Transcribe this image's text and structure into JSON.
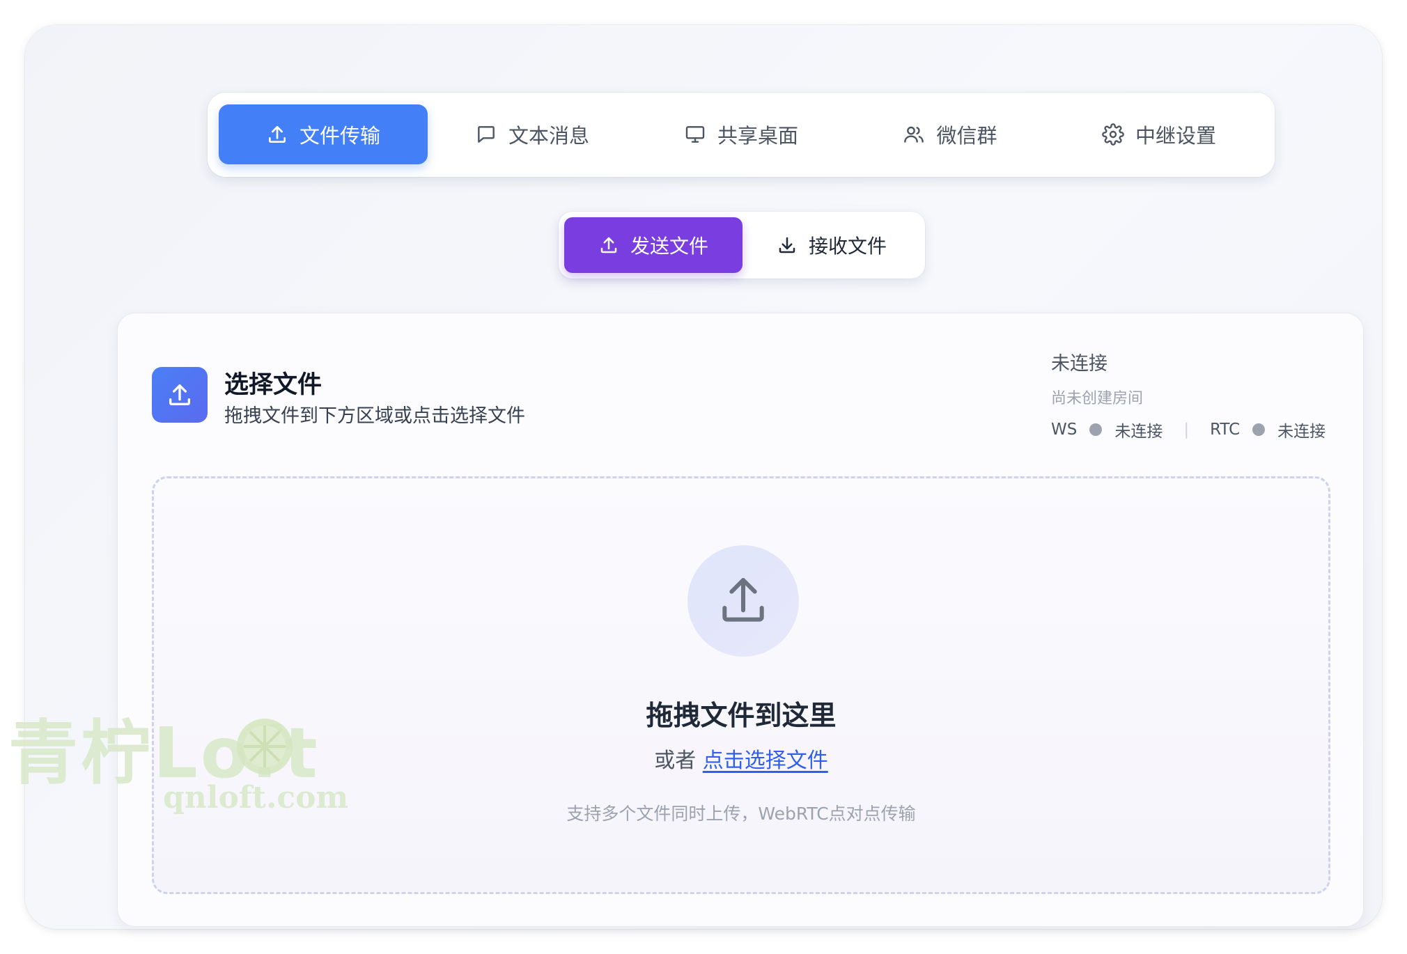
{
  "main_nav": {
    "tabs": [
      {
        "label": "文件传输",
        "icon": "upload-icon",
        "active": true
      },
      {
        "label": "文本消息",
        "icon": "message-icon",
        "active": false
      },
      {
        "label": "共享桌面",
        "icon": "monitor-icon",
        "active": false
      },
      {
        "label": "微信群",
        "icon": "users-icon",
        "active": false
      },
      {
        "label": "中继设置",
        "icon": "gear-icon",
        "active": false
      }
    ]
  },
  "transfer_mode": {
    "send_label": "发送文件",
    "receive_label": "接收文件",
    "active": "send"
  },
  "select_panel": {
    "title": "选择文件",
    "subtitle": "拖拽文件到下方区域或点击选择文件"
  },
  "connection": {
    "status": "未连接",
    "room_status": "尚未创建房间",
    "ws_label": "WS",
    "ws_status": "未连接",
    "separator": "|",
    "rtc_label": "RTC",
    "rtc_status": "未连接",
    "indicator_color": "#9ca3af"
  },
  "drop_zone": {
    "title": "拖拽文件到这里",
    "or_text": "或者",
    "link_text": "点击选择文件",
    "hint": "支持多个文件同时上传，WebRTC点对点传输"
  },
  "watermark": {
    "brand": "青柠Loft",
    "domain": "qnloft.com"
  },
  "colors": {
    "primary_blue": "#4380f8",
    "primary_purple": "#7a3ee0",
    "link_blue": "#2f5ef0"
  }
}
